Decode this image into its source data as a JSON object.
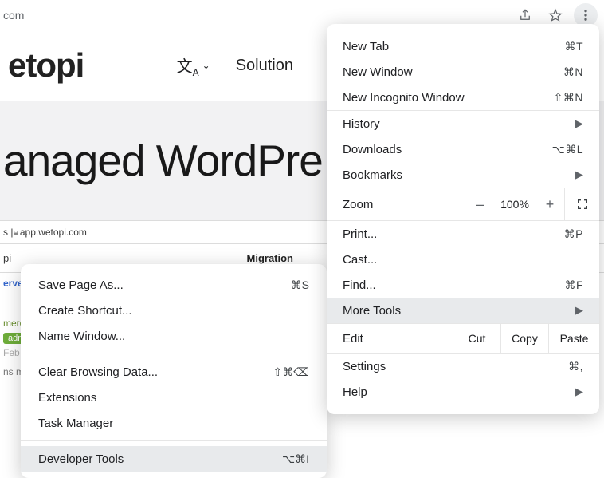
{
  "toolbar": {
    "url_suffix": "com"
  },
  "page": {
    "logo": "etopi",
    "nav_solutions": "Solution",
    "hero": "anaged WordPre",
    "app_url_prefix": "s | ",
    "app_url": "app.wetopi.com",
    "tab_left": "pi",
    "tab_right": "Migration",
    "servers": "erve",
    "merco": "merco",
    "admin": "admi",
    "feb": "Feb",
    "nsme": "ns me"
  },
  "menu": {
    "new_tab": "New Tab",
    "sc_new_tab": "⌘T",
    "new_window": "New Window",
    "sc_new_window": "⌘N",
    "new_incognito": "New Incognito Window",
    "sc_new_incognito": "⇧⌘N",
    "history": "History",
    "downloads": "Downloads",
    "sc_downloads": "⌥⌘L",
    "bookmarks": "Bookmarks",
    "zoom": "Zoom",
    "zoom_minus": "–",
    "zoom_value": "100%",
    "zoom_plus": "+",
    "print": "Print...",
    "sc_print": "⌘P",
    "cast": "Cast...",
    "find": "Find...",
    "sc_find": "⌘F",
    "more_tools": "More Tools",
    "edit": "Edit",
    "cut": "Cut",
    "copy": "Copy",
    "paste": "Paste",
    "settings": "Settings",
    "sc_settings": "⌘,",
    "help": "Help"
  },
  "submenu": {
    "save_as": "Save Page As...",
    "sc_save_as": "⌘S",
    "create_shortcut": "Create Shortcut...",
    "name_window": "Name Window...",
    "clear_browsing": "Clear Browsing Data...",
    "sc_clear": "⇧⌘⌫",
    "extensions": "Extensions",
    "task_manager": "Task Manager",
    "dev_tools": "Developer Tools",
    "sc_dev": "⌥⌘I"
  }
}
